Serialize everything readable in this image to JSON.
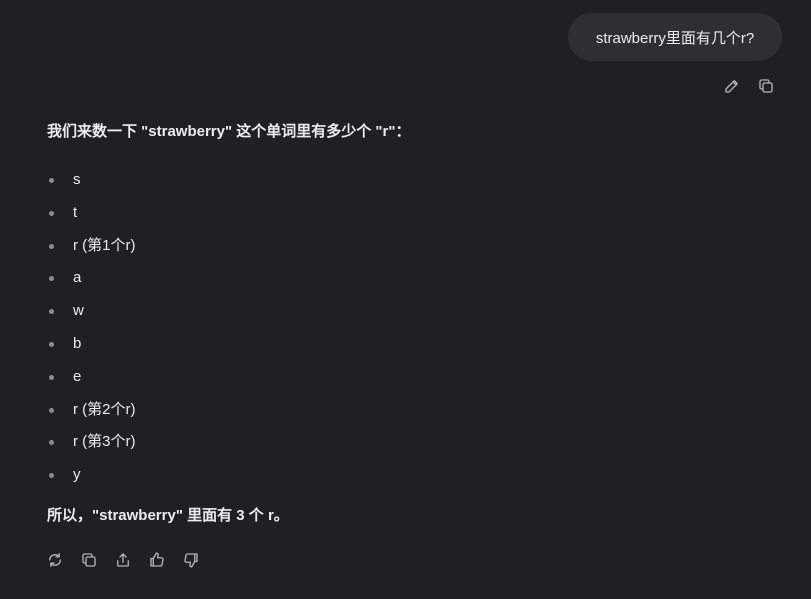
{
  "user_message": {
    "text": "strawberry里面有几个r?"
  },
  "user_actions": [
    "edit-icon",
    "copy-icon"
  ],
  "assistant": {
    "intro": "我们来数一下 \"strawberry\" 这个单词里有多少个 \"r\"：",
    "letters": [
      "s",
      "t",
      "r (第1个r)",
      "a",
      "w",
      "b",
      "e",
      "r (第2个r)",
      "r (第3个r)",
      "y"
    ],
    "conclusion_prefix": "所以，\"strawberry\" 里面有 ",
    "conclusion_count": "3 个",
    "conclusion_suffix": " r。"
  },
  "reply_actions": [
    "regenerate-icon",
    "copy-icon",
    "share-icon",
    "thumbs-up-icon",
    "thumbs-down-icon"
  ]
}
